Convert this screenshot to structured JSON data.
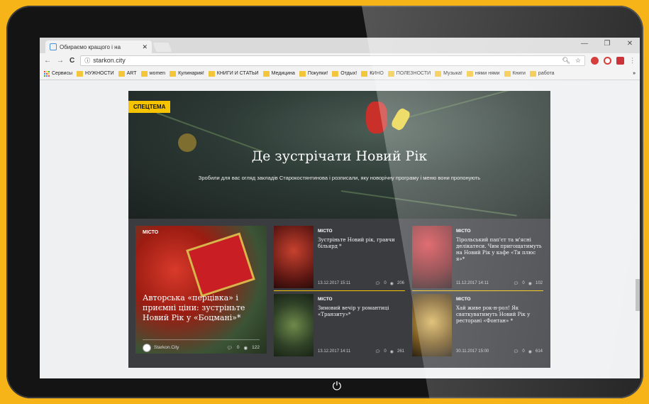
{
  "browser": {
    "tab_title": "Обираємо кращого і на",
    "tab_close": "✕",
    "url": "starkon.city",
    "window_controls": [
      "—",
      "❐",
      "✕"
    ],
    "bookmarks": [
      {
        "label": "Сервисы",
        "kind": "apps"
      },
      {
        "label": "НУЖНОСТИ"
      },
      {
        "label": "ART"
      },
      {
        "label": "women"
      },
      {
        "label": "Кулинария!"
      },
      {
        "label": "КНИГИ И СТАТЬИ"
      },
      {
        "label": "Медицина"
      },
      {
        "label": "Покупки!"
      },
      {
        "label": "Отдых!"
      },
      {
        "label": "КИНО"
      },
      {
        "label": "ПОЛЕЗНОСТИ"
      },
      {
        "label": "Музыка!"
      },
      {
        "label": "нями нями"
      },
      {
        "label": "Книги"
      },
      {
        "label": "работа"
      }
    ],
    "bookmarks_more": "»"
  },
  "hero": {
    "badge": "СПЕЦТЕМА",
    "title": "Де зустрічати Новий Рік",
    "subtitle": "Зробили для вас огляд закладів Старокостянтинова і розписали, яку новорічну програму і меню вони пропонують"
  },
  "feature": {
    "category": "МІСТО",
    "title": "Авторська «перцівка» і приємні ціни: зустріньте Новий Рік у «Боцмані»*",
    "author": "Starkon.City",
    "comments": "0",
    "views": "122"
  },
  "cards": [
    {
      "category": "МІСТО",
      "title": "Зустріньте Новий рік, гравчи більярд *",
      "date": "13.12.2017 15:11",
      "comments": "0",
      "views": "206"
    },
    {
      "category": "МІСТО",
      "title": "Тірольський пап'єт та м'ясні делікатеси. Чим пригощатимуть на Новий Рік у кафе «Ти плюс я»*",
      "date": "11.12.2017 14:11",
      "comments": "0",
      "views": "102"
    },
    {
      "category": "МІСТО",
      "title": "Зимовий вечір у романтиці «Транзиту»*",
      "date": "13.12.2017 14:11",
      "comments": "0",
      "views": "261"
    },
    {
      "category": "МІСТО",
      "title": "Хай живе рок-н-рол! Як святкуватимуть Новий Рік у ресторані «Фонтан» *",
      "date": "30.11.2017 15:00",
      "comments": "0",
      "views": "614"
    }
  ],
  "colors": {
    "device_bg": "#f6b419",
    "accent": "#f6c300",
    "news_bg": "#3a3c40"
  }
}
